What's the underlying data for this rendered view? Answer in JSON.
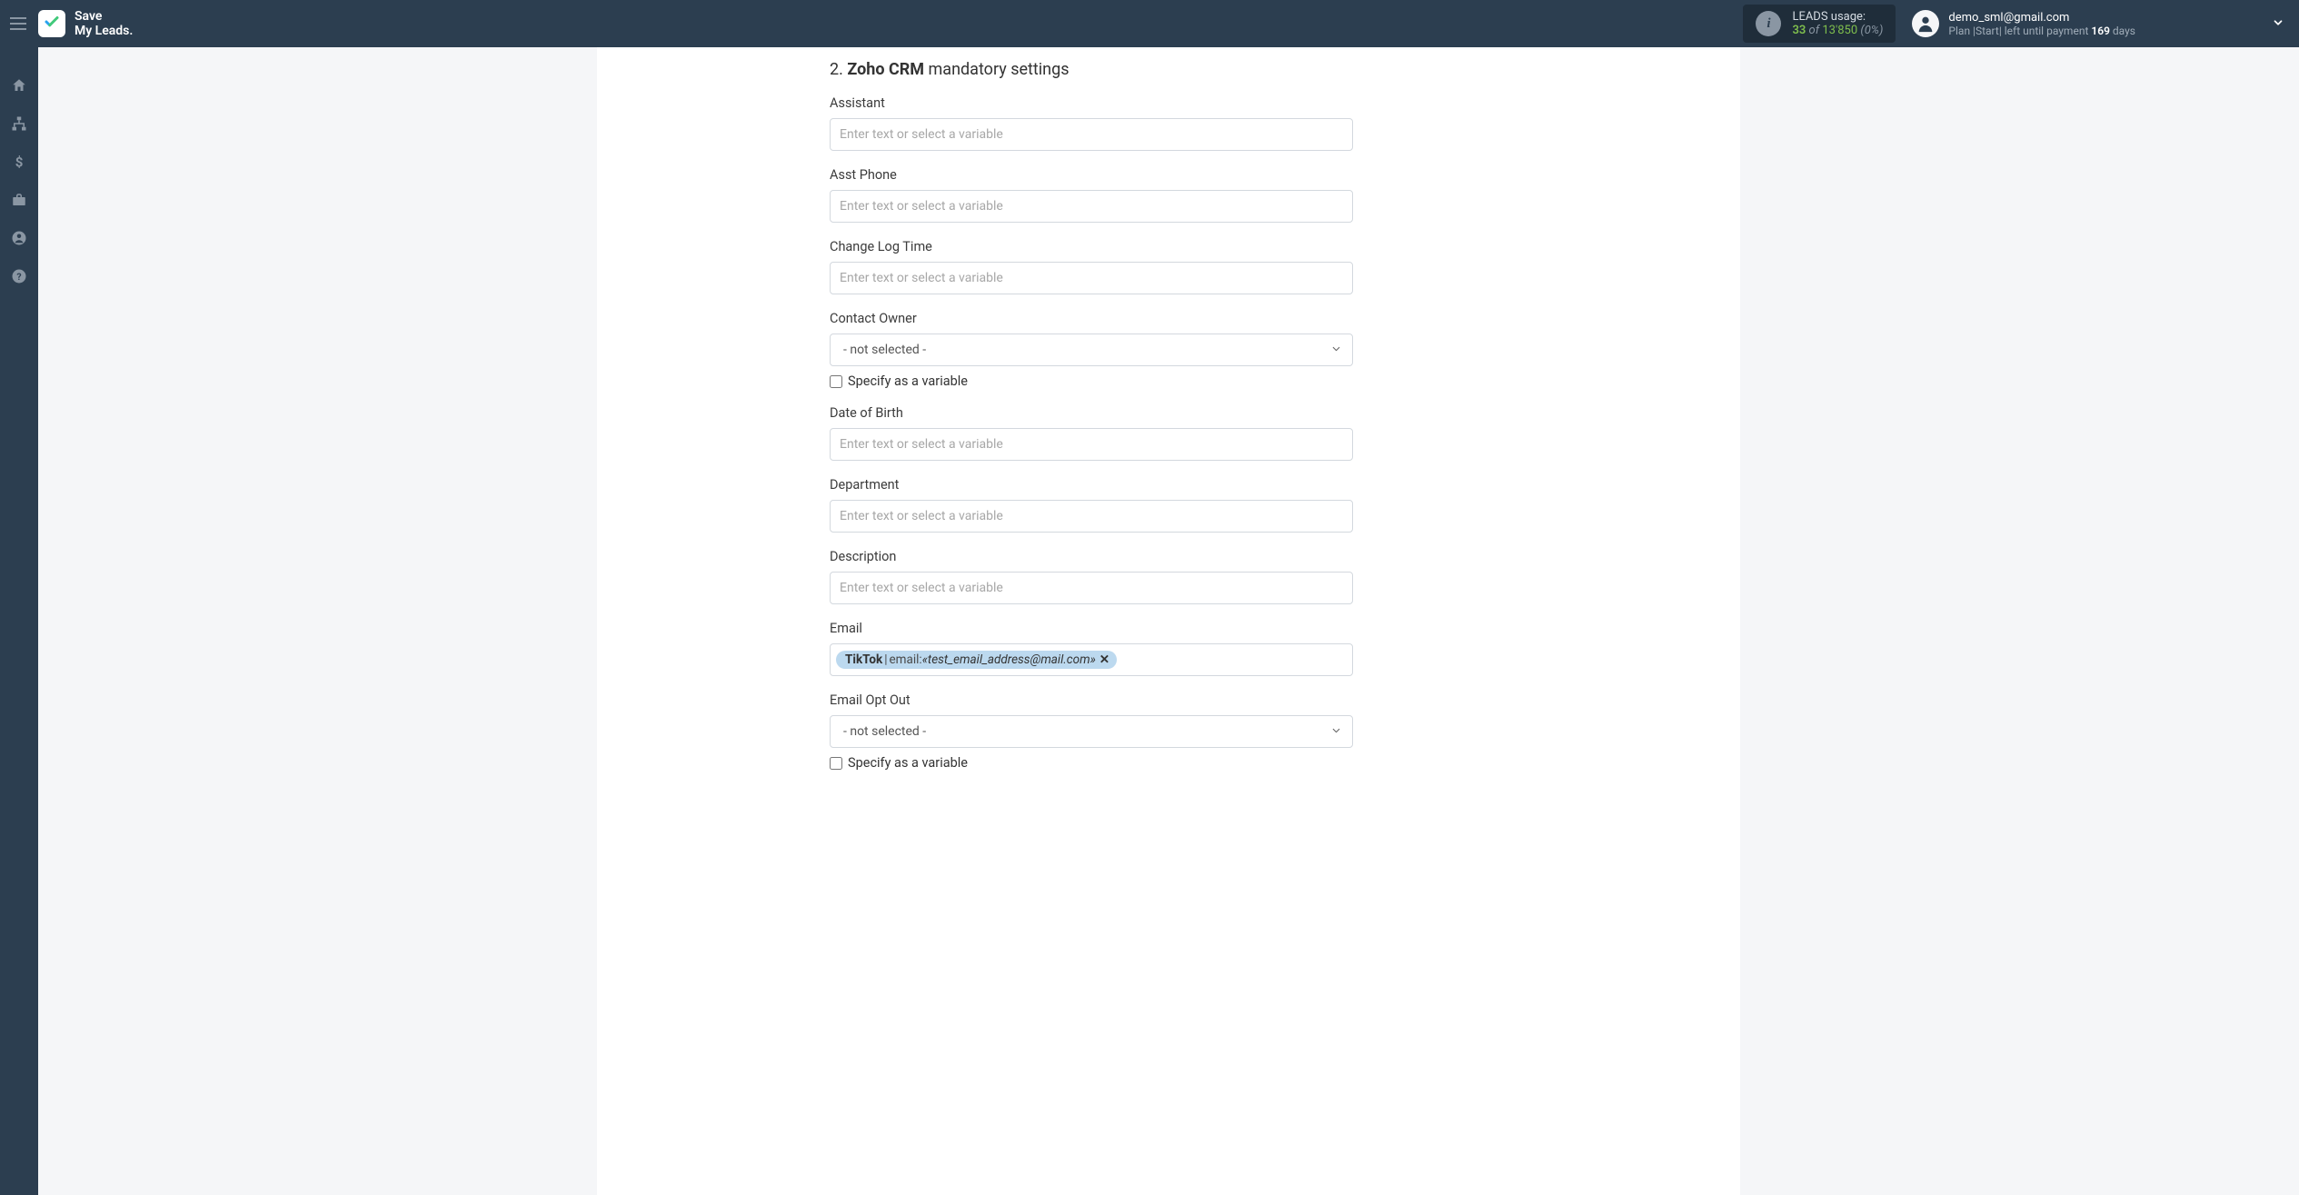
{
  "brand": {
    "line1": "Save",
    "line2": "My Leads."
  },
  "usage": {
    "label": "LEADS usage:",
    "current": "33",
    "of": "of",
    "max": "13'850",
    "pct": "(0%)"
  },
  "account": {
    "email": "demo_sml@gmail.com",
    "plan_prefix": "Plan |Start| left until payment ",
    "plan_days": "169",
    "plan_suffix": " days"
  },
  "section": {
    "number": "2.",
    "strong": "Zoho CRM",
    "rest": " mandatory settings"
  },
  "placeholder": "Enter text or select a variable",
  "not_selected": "- not selected -",
  "specify_var": "Specify as a variable",
  "fields": {
    "assistant": "Assistant",
    "asst_phone": "Asst Phone",
    "change_log_time": "Change Log Time",
    "contact_owner": "Contact Owner",
    "date_of_birth": "Date of Birth",
    "department": "Department",
    "description": "Description",
    "email": "Email",
    "email_opt_out": "Email Opt Out"
  },
  "email_tag": {
    "source": "TikTok",
    "separator": " | ",
    "label": "email: ",
    "value": "«test_email_address@mail.com»"
  }
}
